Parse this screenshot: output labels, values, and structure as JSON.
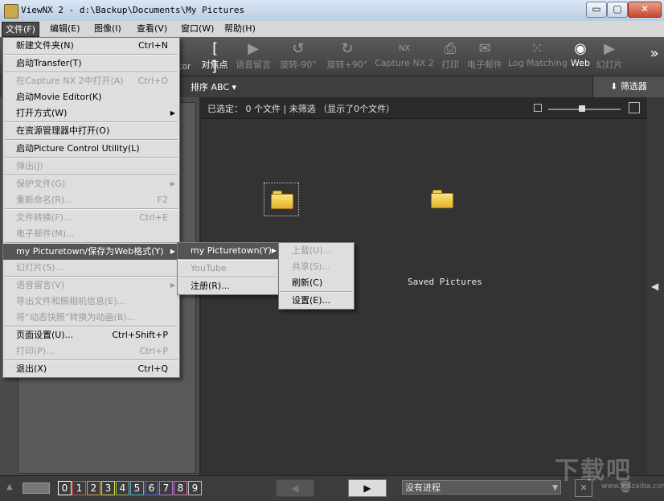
{
  "window": {
    "title": "ViewNX 2 - d:\\Backup\\Documents\\My Pictures",
    "minimize": "▭",
    "maximize": "▢",
    "close": "✕"
  },
  "menubar": [
    "文件(F)",
    "编辑(E)",
    "图像(I)",
    "查看(V)",
    "窗口(W)",
    "帮助(H)"
  ],
  "toolbar": {
    "partial": "tor",
    "items": [
      {
        "label": "对焦点",
        "icon": "[ ]"
      },
      {
        "label": "语音留言",
        "icon": "▶"
      },
      {
        "label": "旋转-90°",
        "icon": "↺"
      },
      {
        "label": "旋转+90°",
        "icon": "↻"
      },
      {
        "label": "Capture NX 2",
        "icon": "NX"
      },
      {
        "label": "打印",
        "icon": "⎙"
      },
      {
        "label": "电子邮件",
        "icon": "✉"
      },
      {
        "label": "Log Matching",
        "icon": "⁙"
      },
      {
        "label": "Web",
        "icon": "◉"
      },
      {
        "label": "幻灯片",
        "icon": "▶"
      }
    ],
    "more": "»"
  },
  "subbar": {
    "sort": "排序 ABC ▾",
    "filter": "筛选器",
    "filter_icon": "⬇"
  },
  "browser": {
    "status": "已选定：  0 个文件  |  未筛选  （显示了0个文件）",
    "caption": "Saved Pictures",
    "right_arrow": "◀"
  },
  "file_menu": [
    {
      "label": "新建文件夹(N)",
      "shortcut": "Ctrl+N",
      "disabled": false
    },
    {
      "sep": true
    },
    {
      "label": "启动Transfer(T)",
      "shortcut": "",
      "disabled": false
    },
    {
      "sep": true
    },
    {
      "label": "在Capture NX 2中打开(A)",
      "shortcut": "Ctrl+O",
      "disabled": true
    },
    {
      "label": "启动Movie Editor(K)",
      "shortcut": "",
      "disabled": false
    },
    {
      "label": "打开方式(W)",
      "shortcut": "",
      "submenu": true,
      "disabled": false
    },
    {
      "sep": true
    },
    {
      "label": "在资源管理器中打开(O)",
      "shortcut": "",
      "disabled": false
    },
    {
      "sep": true
    },
    {
      "label": "启动Picture Control Utility(L)",
      "shortcut": "",
      "disabled": false
    },
    {
      "sep": true
    },
    {
      "label": "弹出(J)",
      "shortcut": "",
      "disabled": true
    },
    {
      "sep": true
    },
    {
      "label": "保护文件(G)",
      "shortcut": "",
      "submenu": true,
      "disabled": true
    },
    {
      "label": "重新命名(R)...",
      "shortcut": "F2",
      "disabled": true
    },
    {
      "sep": true
    },
    {
      "label": "文件转换(F)...",
      "shortcut": "Ctrl+E",
      "disabled": true
    },
    {
      "label": "电子邮件(M)...",
      "shortcut": "",
      "disabled": true
    },
    {
      "sep": true
    },
    {
      "label": "my Picturetown/保存为Web格式(Y)",
      "shortcut": "",
      "submenu": true,
      "highlighted": true,
      "disabled": false
    },
    {
      "label": "幻灯片(S)...",
      "shortcut": "",
      "disabled": true
    },
    {
      "sep": true
    },
    {
      "label": "语音留言(V)",
      "shortcut": "",
      "submenu": true,
      "disabled": true
    },
    {
      "label": "导出文件和照相机信息(E)...",
      "shortcut": "",
      "disabled": true
    },
    {
      "label": "将“动态快照”转换为动画(B)...",
      "shortcut": "",
      "disabled": true
    },
    {
      "sep": true
    },
    {
      "label": "页面设置(U)...",
      "shortcut": "Ctrl+Shift+P",
      "disabled": false
    },
    {
      "label": "打印(P)...",
      "shortcut": "Ctrl+P",
      "disabled": true
    },
    {
      "sep": true
    },
    {
      "label": "退出(X)",
      "shortcut": "Ctrl+Q",
      "disabled": false
    }
  ],
  "submenu1": [
    {
      "label": "my Picturetown(Y)",
      "submenu": true,
      "highlighted": true,
      "disabled": false
    },
    {
      "sep": true
    },
    {
      "label": "YouTube",
      "disabled": true
    },
    {
      "sep": true
    },
    {
      "label": "注册(R)...",
      "disabled": false
    }
  ],
  "submenu2": [
    {
      "label": "上载(U)...",
      "disabled": true
    },
    {
      "label": "共享(S)...",
      "disabled": true
    },
    {
      "label": "刷新(C)",
      "disabled": false
    },
    {
      "sep": true
    },
    {
      "label": "设置(E)...",
      "disabled": false
    }
  ],
  "bottom": {
    "labels": [
      "0",
      "1",
      "2",
      "3",
      "4",
      "5",
      "6",
      "7",
      "8",
      "9"
    ],
    "label_colors": [
      "#ffffff",
      "#e05050",
      "#e0a040",
      "#e0e050",
      "#80c060",
      "#50b0e0",
      "#5070e0",
      "#b070e0",
      "#e070b0",
      "#c0c0c0"
    ],
    "prev": "◀",
    "play": "▶",
    "progress": "没有进程",
    "cancel": "✕",
    "trash": "🗑"
  },
  "watermark": {
    "text": "下载吧",
    "url": "www.xiazaiba.com"
  }
}
